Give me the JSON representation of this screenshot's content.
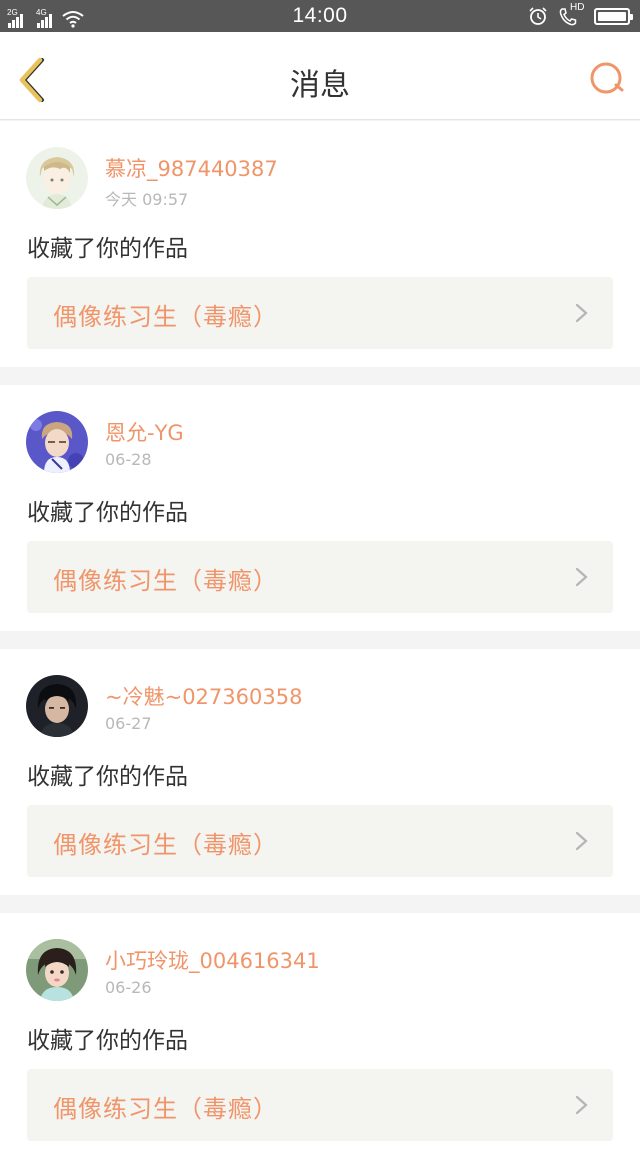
{
  "status_bar": {
    "network1": "2G",
    "network2": "4G",
    "time": "14:00",
    "hd_label": "HD",
    "icons": [
      "signal-icon",
      "wifi-icon",
      "alarm-icon",
      "hd-call-icon",
      "battery-icon"
    ]
  },
  "nav": {
    "title": "消息",
    "back_icon": "chevron-left-icon",
    "search_icon": "search-icon"
  },
  "colors": {
    "accent": "#f0956a",
    "back_icon": "#e8c25a",
    "text": "#333333",
    "muted": "#b8b8b8",
    "work_box_bg": "#f4f4f0",
    "status_bar_bg": "#575757"
  },
  "messages": [
    {
      "user": "慕凉_987440387",
      "time": "今天 09:57",
      "action": "收藏了你的作品",
      "work": "偶像练习生（毒瘾）"
    },
    {
      "user": "恩允-YG",
      "time": "06-28",
      "action": "收藏了你的作品",
      "work": "偶像练习生（毒瘾）"
    },
    {
      "user": "~冷魅~027360358",
      "time": "06-27",
      "action": "收藏了你的作品",
      "work": "偶像练习生（毒瘾）"
    },
    {
      "user": "小巧玲珑_004616341",
      "time": "06-26",
      "action": "收藏了你的作品",
      "work": "偶像练习生（毒瘾）"
    }
  ]
}
